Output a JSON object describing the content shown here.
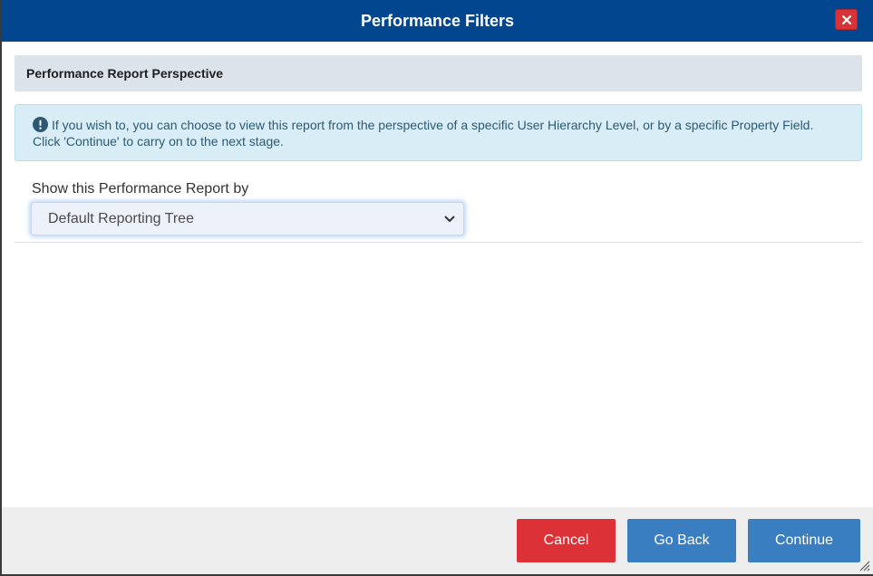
{
  "dialog": {
    "title": "Performance Filters",
    "close_icon": "close-icon"
  },
  "section": {
    "header": "Performance Report Perspective"
  },
  "info": {
    "icon": "info-exclamation-icon",
    "message": "If you wish to, you can choose to view this report from the perspective of a specific User Hierarchy Level, or by a specific Property Field. Click 'Continue' to carry on to the next stage."
  },
  "perspective": {
    "label": "Show this Performance Report by",
    "selected": "Default Reporting Tree"
  },
  "footer": {
    "cancel_label": "Cancel",
    "go_back_label": "Go Back",
    "continue_label": "Continue"
  },
  "colors": {
    "titlebar": "#02468f",
    "cancel": "#dc3136",
    "primary": "#3a7ec2",
    "info_background": "#d8edf6"
  }
}
